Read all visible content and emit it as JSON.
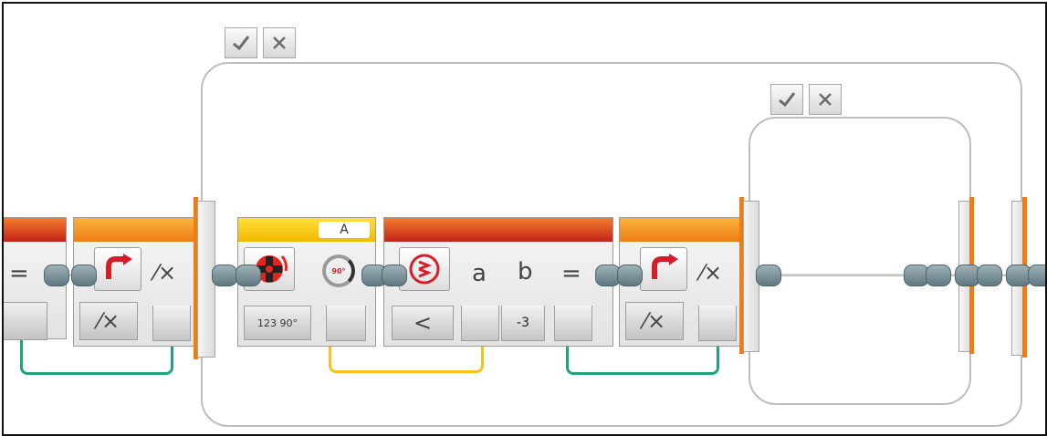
{
  "loops": {
    "outer": {
      "check_icon": "checkmark-icon",
      "close_icon": "close-x-icon"
    },
    "inner": {
      "check_icon": "checkmark-icon",
      "close_icon": "close-x-icon"
    }
  },
  "blocks": {
    "compare_left": {
      "operator": "="
    },
    "logic_left": {
      "result_symbol": "⁄×",
      "mode_symbol": "⁄×"
    },
    "motor": {
      "port": "A",
      "degrees_label": "90°",
      "mode_label": "123 90°"
    },
    "compare": {
      "input_a": "a",
      "input_b": "b",
      "operator": "=",
      "mode": "<",
      "value_b": "-3"
    },
    "logic_right": {
      "result_symbol": "⁄×",
      "mode_symbol": "⁄×"
    }
  },
  "colors": {
    "wire_green": "#1fa57a",
    "wire_yellow": "#f4c21b",
    "loop_border": "#ee7d15",
    "accent_red": "#d71d2a"
  }
}
